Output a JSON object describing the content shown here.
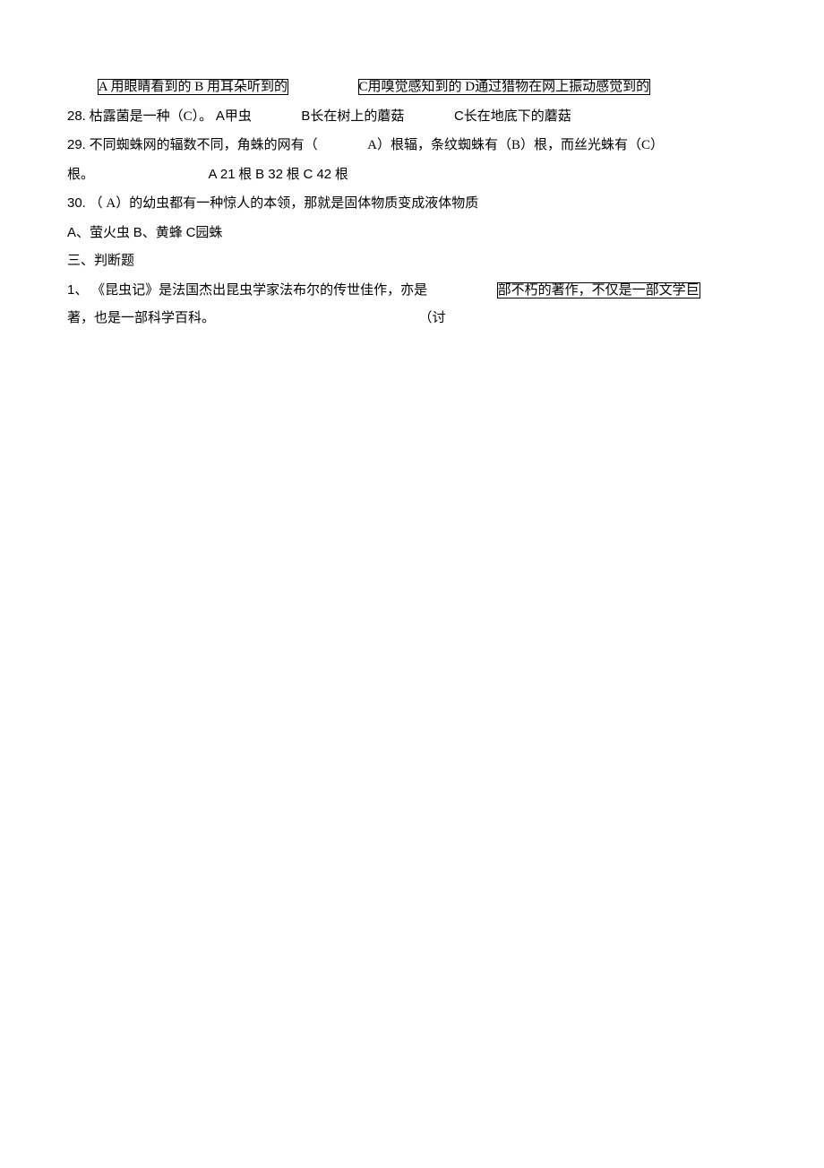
{
  "line1": {
    "boxed1": "A 用眼睛看到的 B 用耳朵听到的",
    "boxed2": "C用嗅觉感知到的 D通过猎物在网上振动感觉到的"
  },
  "line2": {
    "num": "28.",
    "text1": "枯露菌是一种（C）。",
    "optA": "A甲虫",
    "optB": "B长在树上的蘑菇",
    "optC": "C长在地底下的蘑菇"
  },
  "line3": {
    "num": "29.",
    "text1": "不同蜘蛛网的辐数不同，角蛛的网有（",
    "text2": "A）根辐，条纹蜘蛛有（B）根，而丝光蛛有（C）"
  },
  "line4": {
    "text1": "根。",
    "opts": "A 21 根 B 32 根 C 42 根"
  },
  "line5": {
    "num": "30.",
    "text1": "（ A）的幼虫都有一种惊人的本领，那就是固体物质变成液体物质"
  },
  "line6": {
    "text": "A、萤火虫 B、黄蜂 C园蛛"
  },
  "line7": {
    "text": "三、判断题"
  },
  "line8": {
    "num": "1、",
    "text1": "《昆虫记》是法国杰出昆虫学家法布尔的传世佳作，亦是",
    "boxed": "部不朽的著作，不仅是一部文学巨"
  },
  "line9": {
    "text1": "著，也是一部科学百科。",
    "text2": "（讨"
  }
}
